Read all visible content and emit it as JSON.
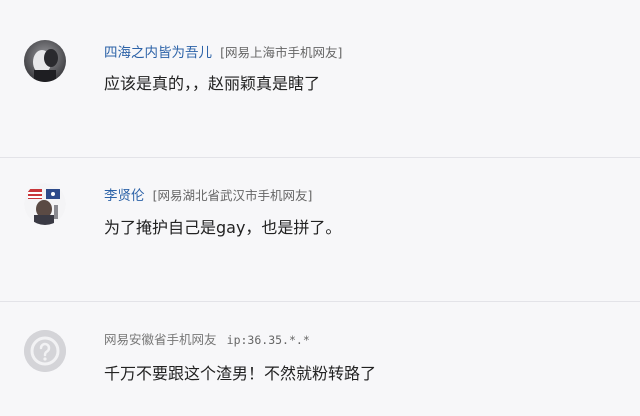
{
  "comments": [
    {
      "username": "四海之内皆为吾儿",
      "location": "[网易上海市手机网友]",
      "text": "应该是真的，，赵丽颖真是瞎了",
      "avatar_icon": "avatar-photo-icon"
    },
    {
      "username": "李贤伦",
      "location": "[网易湖北省武汉市手机网友]",
      "text": "为了掩护自己是gay，也是拼了。",
      "avatar_icon": "avatar-flag-icon"
    },
    {
      "username": "网易安徽省手机网友",
      "ip": "ip:36.35.*.*",
      "text": "千万不要跟这个渣男！不然就粉转路了",
      "avatar_icon": "default-avatar-icon"
    }
  ]
}
